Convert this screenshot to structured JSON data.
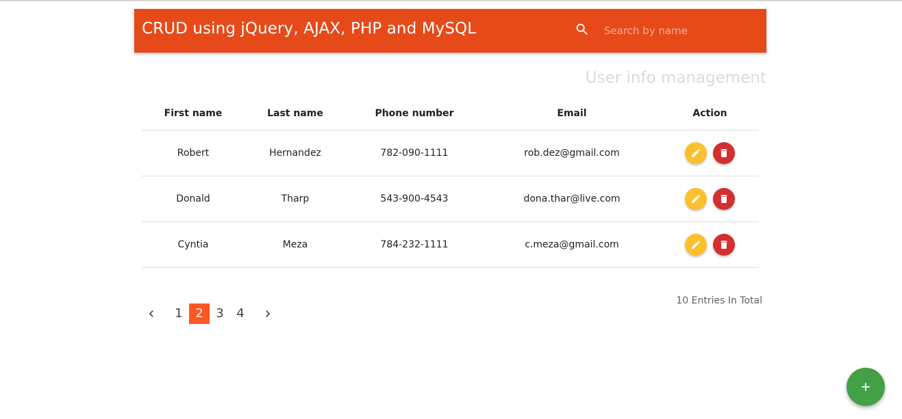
{
  "header": {
    "title": "CRUD using jQuery, AJAX, PHP and MySQL",
    "search_placeholder": "Search by name",
    "search_value": ""
  },
  "subtitle": "User info management",
  "table": {
    "columns": [
      "First name",
      "Last name",
      "Phone number",
      "Email",
      "Action"
    ],
    "rows": [
      {
        "first": "Robert",
        "last": "Hernandez",
        "phone": "782-090-1111",
        "email": "rob.dez@gmail.com"
      },
      {
        "first": "Donald",
        "last": "Tharp",
        "phone": "543-900-4543",
        "email": "dona.thar@live.com"
      },
      {
        "first": "Cyntia",
        "last": "Meza",
        "phone": "784-232-1111",
        "email": "c.meza@gmail.com"
      }
    ],
    "action_icons": {
      "edit": "pencil-icon",
      "delete": "trash-icon"
    }
  },
  "pagination": {
    "pages": [
      "1",
      "2",
      "3",
      "4"
    ],
    "current": "2",
    "prev_icon": "chevron-left-icon",
    "next_icon": "chevron-right-icon"
  },
  "entries_total": "10 Entries In Total",
  "fab": {
    "icon": "plus-icon"
  },
  "colors": {
    "app_bar": "#e64a19",
    "active_page": "#ff5722",
    "edit_button": "#fbc02d",
    "delete_button": "#d32f2f",
    "fab": "#43a047"
  }
}
